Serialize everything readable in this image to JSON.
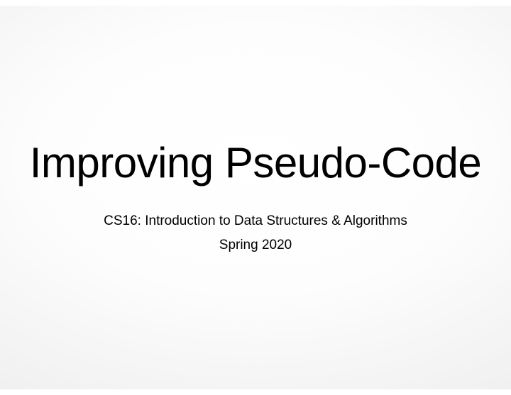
{
  "slide": {
    "title": "Improving Pseudo-Code",
    "subtitle": "CS16: Introduction to Data Structures & Algorithms",
    "term": "Spring 2020"
  }
}
